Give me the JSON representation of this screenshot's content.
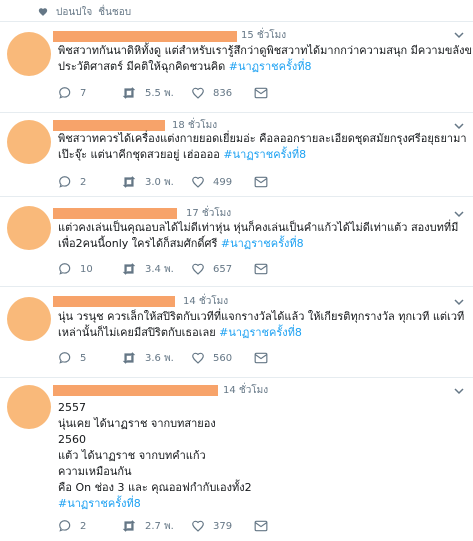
{
  "header": {
    "heart_icon": "heart-icon",
    "liked_by_text": "ปอนปใจ",
    "liked_suffix": "ชื่นชอบ"
  },
  "colors": {
    "accent": "#1da1f2",
    "muted": "#657786",
    "redaction": "#f7a36a",
    "avatar": "#f9b97a"
  },
  "tweets": [
    {
      "timestamp": "15 ชั่วโมง",
      "lines": [
        "พิชสวาทกันนาดิหิทั้งดู แต่สำหรับเรารู้สึกว่าดูพิชสวาทได้มากกว่าความสนุก มีความขลังของ",
        "ประวัติศาสตร์ มีคติให้ฉุกคิดชวนคิด "
      ],
      "hashtag": "#นาฏราชครั้งที่8",
      "replies": "7",
      "retweets": "5.5 พ.",
      "likes": "836"
    },
    {
      "timestamp": "18 ชั่วโมง",
      "lines": [
        "พิชสวาทควรได้เครื่องแต่งกายยอดเยี่ยมอ่ะ คือลออกรายละเอียดชุดสมัยกรุงศรีอยุธยามา",
        "เป๊ะจุ๊ะ แต่นาคีกชุดสวยอยู่ เฮ่ออออ "
      ],
      "hashtag": "#นาฏราชครั้งที่8",
      "replies": "2",
      "retweets": "3.0 พ.",
      "likes": "499"
    },
    {
      "timestamp": "17 ชั่วโมง",
      "lines": [
        "แต่วคงเล่นเป็นคุณอบลได้ไม่ดีเท่าหุ่น หุ่นก็คงเล่นเป็นคำแก้วได้ไม่ดีเท่าแต้ว สองบทที่มี",
        "เพื่อ2คนนี้only ใครได้ก็สมศักดิ์ศรี "
      ],
      "hashtag": "#นาฏราชครั้งที่8",
      "replies": "10",
      "retweets": "3.4 พ.",
      "likes": "657"
    },
    {
      "timestamp": "14 ชั่วโมง",
      "lines": [
        "นุ่น วรนุช ควรเล็กให้สปิริตกับเวทีที่แจกรางวัลได้แล้ว ให้เกียรติทุกรางวัล ทุกเวที แต่เวที",
        "เหล่านั้นก็ไม่เคยมีสปิริตกับเธอเลย "
      ],
      "hashtag": "#นาฏราชครั้งที่8",
      "replies": "5",
      "retweets": "3.6 พ.",
      "likes": "560"
    },
    {
      "timestamp": "14 ชั่วโมง",
      "lines": [
        "2557",
        "นุ่นเคย ได้นาฏราช จากบทสายอง",
        "2560",
        "แต้ว ได้นาฏราช จากบทคำแก้ว",
        "ความเหมือนกัน",
        "คือ On ช่อง 3 และ คุณออฟกำกับเองทั้ง2"
      ],
      "hashtag": "#นาฏราชครั้งที่8",
      "replies": "2",
      "retweets": "2.7 พ.",
      "likes": "379"
    }
  ]
}
